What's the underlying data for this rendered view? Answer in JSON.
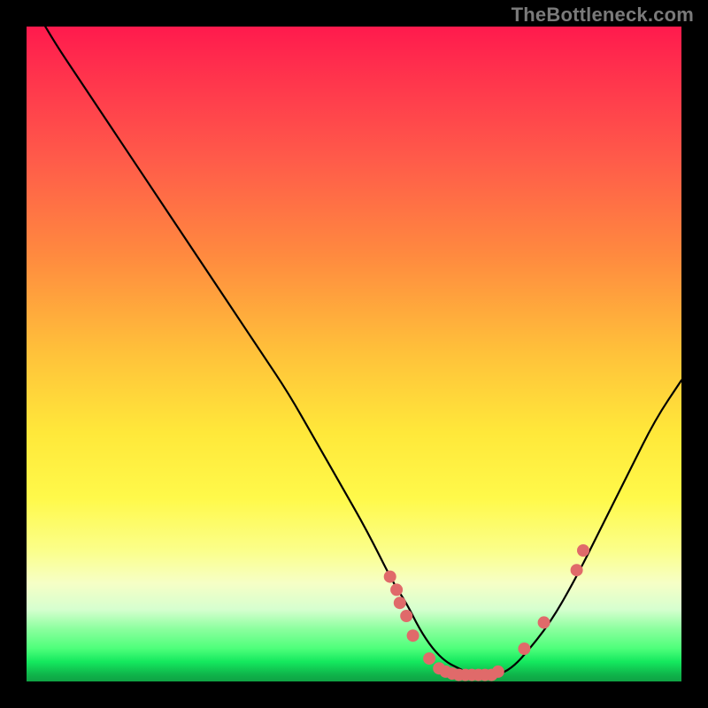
{
  "watermark": "TheBottleneck.com",
  "chart_data": {
    "type": "line",
    "title": "",
    "xlabel": "",
    "ylabel": "",
    "xlim": [
      0,
      100
    ],
    "ylim": [
      0,
      100
    ],
    "series": [
      {
        "name": "bottleneck-curve",
        "x": [
          0,
          4,
          8,
          12,
          16,
          20,
          24,
          28,
          32,
          36,
          40,
          44,
          48,
          52,
          56,
          58,
          60,
          62,
          64,
          66,
          68,
          70,
          72,
          74,
          76,
          80,
          84,
          88,
          92,
          96,
          100
        ],
        "values": [
          105,
          98,
          92,
          86,
          80,
          74,
          68,
          62,
          56,
          50,
          44,
          37,
          30,
          23,
          15,
          12,
          8,
          5,
          3,
          2,
          1,
          1,
          1,
          2,
          4,
          9,
          16,
          24,
          32,
          40,
          46
        ]
      }
    ],
    "markers": {
      "name": "highlight-points",
      "color": "#e06a6a",
      "points": [
        {
          "x": 55.5,
          "y": 16
        },
        {
          "x": 56.5,
          "y": 14
        },
        {
          "x": 57,
          "y": 12
        },
        {
          "x": 58,
          "y": 10
        },
        {
          "x": 59,
          "y": 7
        },
        {
          "x": 61.5,
          "y": 3.5
        },
        {
          "x": 63,
          "y": 2
        },
        {
          "x": 64,
          "y": 1.5
        },
        {
          "x": 65,
          "y": 1.2
        },
        {
          "x": 66,
          "y": 1
        },
        {
          "x": 67,
          "y": 1
        },
        {
          "x": 68,
          "y": 1
        },
        {
          "x": 69,
          "y": 1
        },
        {
          "x": 70,
          "y": 1
        },
        {
          "x": 71,
          "y": 1
        },
        {
          "x": 72,
          "y": 1.5
        },
        {
          "x": 76,
          "y": 5
        },
        {
          "x": 79,
          "y": 9
        },
        {
          "x": 84,
          "y": 17
        },
        {
          "x": 85,
          "y": 20
        }
      ]
    },
    "gradient_stops": [
      {
        "pos": 0,
        "color": "#ff1a4d"
      },
      {
        "pos": 20,
        "color": "#ff5a4a"
      },
      {
        "pos": 50,
        "color": "#ffc23a"
      },
      {
        "pos": 72,
        "color": "#fff94a"
      },
      {
        "pos": 88,
        "color": "#e6ffc8"
      },
      {
        "pos": 95,
        "color": "#4dff7a"
      },
      {
        "pos": 100,
        "color": "#0fa244"
      }
    ]
  }
}
